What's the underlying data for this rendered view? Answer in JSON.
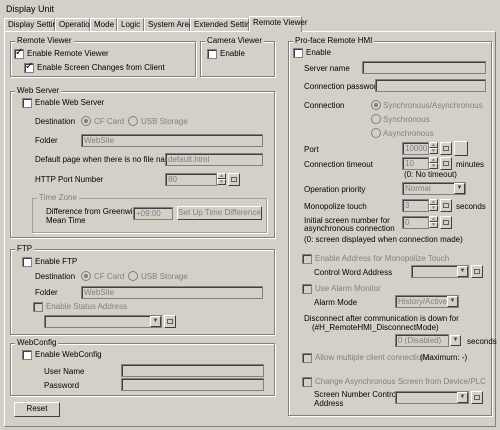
{
  "title": "Display Unit",
  "tabs": [
    "Display Settings",
    "Operation",
    "Mode",
    "Logic",
    "System Area",
    "Extended Settings",
    "Remote Viewer"
  ],
  "remote_viewer": {
    "group": "Remote Viewer",
    "enable": "Enable Remote Viewer",
    "screen_changes": "Enable Screen Changes from Client"
  },
  "camera_viewer": {
    "group": "Camera Viewer",
    "enable": "Enable"
  },
  "web_server": {
    "group": "Web Server",
    "enable": "Enable Web Server",
    "destination_label": "Destination",
    "cf_card": "CF Card",
    "usb_storage": "USB Storage",
    "folder_label": "Folder",
    "folder_value": "WebSite",
    "default_page_label": "Default page when there is no file name",
    "default_page_value": "default.html",
    "http_port_label": "HTTP Port Number",
    "http_port_value": "80",
    "time_zone_group": "Time Zone",
    "gmt_label_1": "Difference from Greenwich",
    "gmt_label_2": "Mean Time",
    "gmt_value": "+09:00",
    "set_time_button": "Set Up Time Difference"
  },
  "ftp": {
    "group": "FTP",
    "enable": "Enable FTP",
    "destination_label": "Destination",
    "cf_card": "CF Card",
    "usb_storage": "USB Storage",
    "folder_label": "Folder",
    "folder_value": "WebSite",
    "status_address": "Enable Status Address"
  },
  "webconfig": {
    "group": "WebConfig",
    "enable": "Enable WebConfig",
    "user_name": "User Name",
    "password": "Password"
  },
  "reset_button": "Reset",
  "remote_hmi": {
    "group": "Pro-face Remote HMI",
    "enable": "Enable",
    "server_name": "Server name",
    "conn_password": "Connection password",
    "connection_label": "Connection",
    "sync_async": "Synchronous/Asynchronous",
    "sync": "Synchronous",
    "async": "Asynchronous",
    "port_label": "Port",
    "port_value": "10000",
    "timeout_label": "Connection timeout",
    "timeout_value": "10",
    "timeout_unit": "minutes",
    "timeout_note": "(0: No timeout)",
    "op_priority_label": "Operation priority",
    "op_priority_value": "Normal",
    "monopolize_label": "Monopolize touch",
    "monopolize_value": "3",
    "monopolize_unit": "seconds",
    "initial_screen_1": "Initial screen number for",
    "initial_screen_2": "asynchronous connection",
    "initial_screen_value": "0",
    "initial_screen_note": "(0: screen displayed when connection made)",
    "enable_monopolize_addr": "Enable Address for Monopolize Touch",
    "control_word": "Control Word Address",
    "use_alarm": "Use Alarm Monitor",
    "alarm_mode_label": "Alarm Mode",
    "alarm_mode_value": "History/Active",
    "disconnect_1": "Disconnect after communication is down for",
    "disconnect_2": "(#H_RemoteHMI_DisconnectMode)",
    "disconnect_value": "0 (Disabled)",
    "disconnect_unit": "seconds",
    "allow_multi": "Allow multiple client connections",
    "maximum": "(Maximum: -)",
    "change_async": "Change Asynchronous Screen from Device/PLC",
    "screen_ctrl_1": "Screen Number Control",
    "screen_ctrl_2": "Address"
  }
}
